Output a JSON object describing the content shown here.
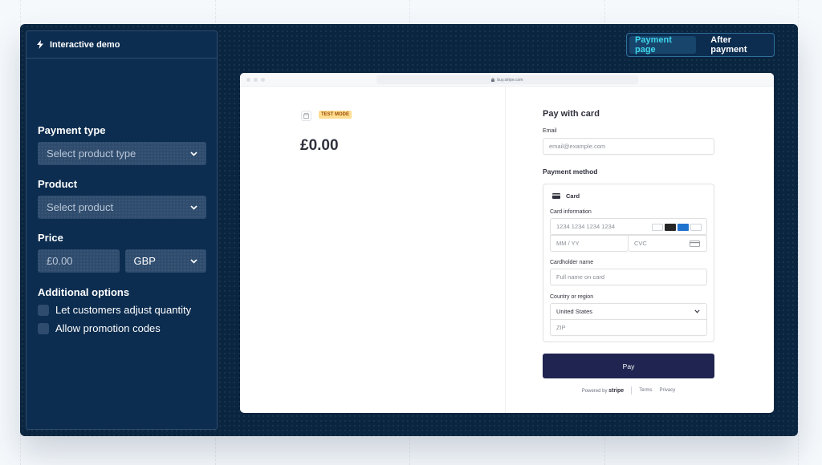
{
  "sidebar": {
    "title": "Interactive demo",
    "payment_type": {
      "label": "Payment type",
      "placeholder": "Select product type"
    },
    "product": {
      "label": "Product",
      "placeholder": "Select product"
    },
    "price": {
      "label": "Price",
      "amount": "£0.00",
      "currency": "GBP"
    },
    "additional": {
      "label": "Additional options",
      "options": [
        "Let customers adjust quantity",
        "Allow promotion codes"
      ]
    }
  },
  "toggle": {
    "active": "Payment page",
    "inactive": "After payment"
  },
  "browser": {
    "url": "buy.stripe.com"
  },
  "checkout": {
    "badge": "TEST MODE",
    "amount": "£0.00",
    "title": "Pay with card",
    "email_label": "Email",
    "email_placeholder": "email@example.com",
    "payment_method_label": "Payment method",
    "card_label": "Card",
    "card_info_label": "Card information",
    "card_number_placeholder": "1234 1234 1234 1234",
    "expiry_placeholder": "MM / YY",
    "cvc_placeholder": "CVC",
    "cardholder_label": "Cardholder name",
    "cardholder_placeholder": "Full name on card",
    "country_label": "Country or region",
    "country_value": "United States",
    "zip_placeholder": "ZIP",
    "pay_label": "Pay",
    "powered_by": "Powered by",
    "stripe": "stripe",
    "terms": "Terms",
    "privacy": "Privacy"
  },
  "colors": {
    "frame": "#0a2540",
    "sidebar": "#0c2d50",
    "accent": "#3fd5ea",
    "pay_button": "#1f2451",
    "badge": "#ffde92"
  }
}
